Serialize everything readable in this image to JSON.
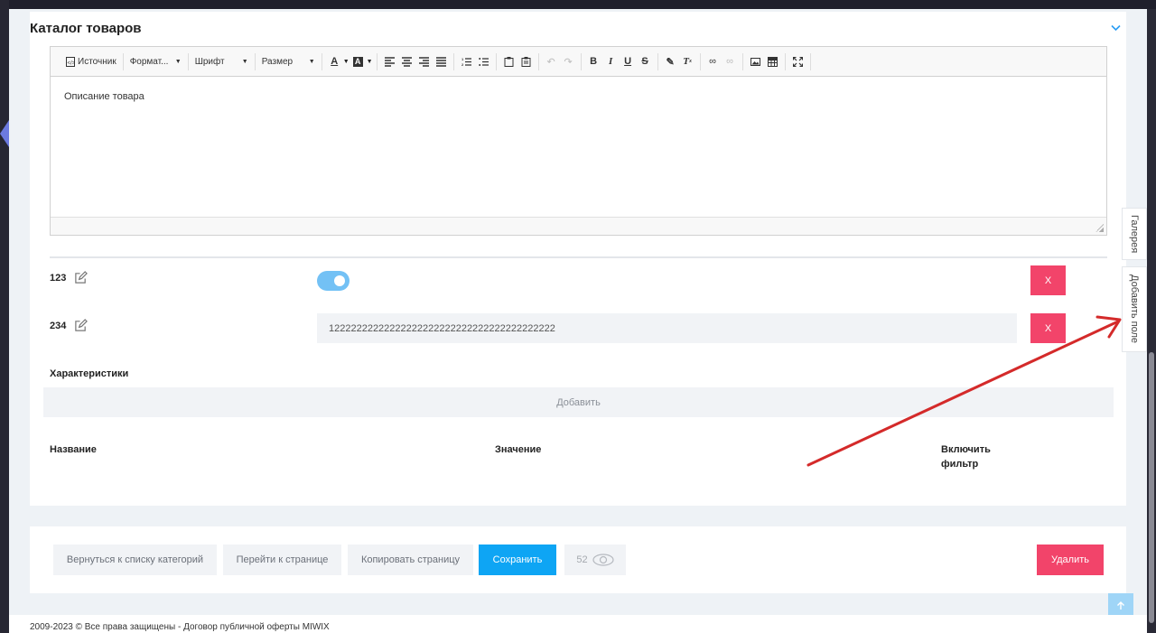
{
  "card": {
    "title": "Каталог товаров"
  },
  "editor": {
    "toolbar": {
      "source": "Источник",
      "format": "Формат...",
      "font": "Шрифт",
      "size": "Размер"
    },
    "content": "Описание товара"
  },
  "fields": [
    {
      "label": "123",
      "type": "toggle",
      "toggle_on": true,
      "delete_label": "X"
    },
    {
      "label": "234",
      "type": "text",
      "value": "12222222222222222222222222222222222222222",
      "delete_label": "X"
    }
  ],
  "characteristics": {
    "title": "Характеристики",
    "add_label": "Добавить",
    "columns": [
      "Название",
      "Значение",
      "Включить фильтр"
    ]
  },
  "side_tabs": {
    "gallery": "Галерея",
    "add_field": "Добавить поле"
  },
  "footer": {
    "back": "Вернуться к списку категорий",
    "goto": "Перейти к странице",
    "copy": "Копировать страницу",
    "save": "Сохранить",
    "views": "52",
    "delete": "Удалить"
  },
  "copyright": "2009-2023 © Все права защищены - Договор публичной оферты MIWIX",
  "colors": {
    "accent": "#0ea5f4",
    "danger": "#f2446a",
    "toggle": "#73c1f5",
    "annotation": "#d42a2a"
  }
}
